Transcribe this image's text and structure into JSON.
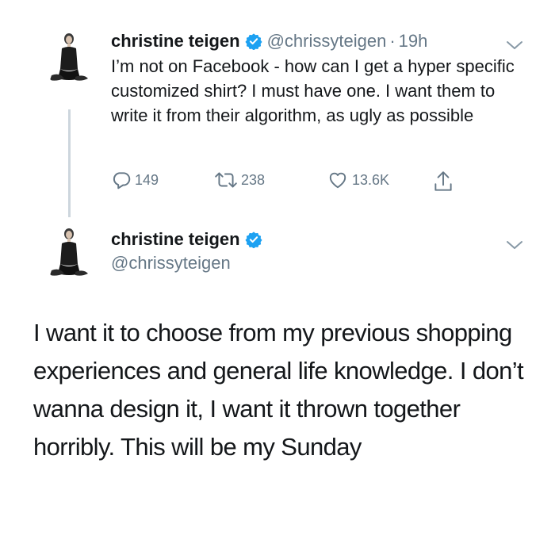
{
  "tweet1": {
    "author_name": "christine teigen",
    "handle": "@chrissyteigen",
    "separator": "·",
    "time": "19h",
    "text": "I’m not on Facebook - how can I get a hyper specific customized shirt? I must have one. I want them to write it from their algorithm, as ugly as possible",
    "replies": "149",
    "retweets": "238",
    "likes": "13.6K"
  },
  "tweet2": {
    "author_name": "christine teigen",
    "handle": "@chrissyteigen",
    "text": "I want it to choose from my previous shopping experiences and general life knowledge. I don’t wanna design it, I want it thrown together horribly. This will be my Sunday"
  },
  "icons": {
    "verified": "verified-badge-icon",
    "reply": "reply-icon",
    "retweet": "retweet-icon",
    "like": "heart-icon",
    "share": "share-icon",
    "menu": "chevron-down-icon"
  },
  "colors": {
    "text": "#14171a",
    "secondary": "#657786",
    "verified_blue": "#1da1f2",
    "thread_line": "#cdd6dd"
  }
}
